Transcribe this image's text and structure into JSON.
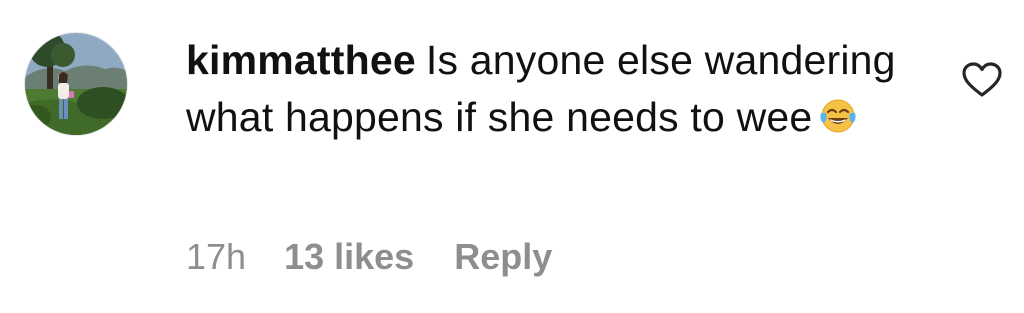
{
  "comment": {
    "username": "kimmatthee",
    "text": "Is anyone else wandering what happens if she needs to wee",
    "emoji": "face-with-tears-of-joy",
    "time": "17h",
    "likes": "13 likes",
    "reply_label": "Reply"
  },
  "icons": {
    "like": "heart-outline-icon"
  },
  "colors": {
    "text": "#111111",
    "meta": "#8e8e8e",
    "icon": "#262626"
  }
}
